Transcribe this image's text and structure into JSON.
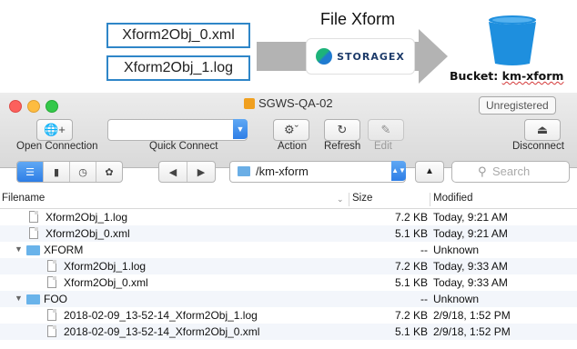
{
  "diagram": {
    "file1": "Xform2Obj_0.xml",
    "file2": "Xform2Obj_1.log",
    "xform_title": "File Xform",
    "storagex_label": "STORAGEX",
    "bucket_prefix": "Bucket: ",
    "bucket_name": "km-xform",
    "colors": {
      "box_border": "#2f86c8",
      "bucket": "#1e8fde",
      "arrow": "#b3b3b3"
    }
  },
  "window": {
    "title": "SGWS-QA-02",
    "unregistered": "Unregistered"
  },
  "toolbar": {
    "open_connection": "Open Connection",
    "quick_connect": "Quick Connect",
    "action": "Action",
    "refresh": "Refresh",
    "edit": "Edit",
    "disconnect": "Disconnect",
    "quick_connect_value": ""
  },
  "nav": {
    "path": "/km-xform",
    "search_placeholder": "Search"
  },
  "table": {
    "columns": {
      "filename": "Filename",
      "size": "Size",
      "modified": "Modified"
    },
    "rows": [
      {
        "name": "Xform2Obj_1.log",
        "size": "7.2 KB",
        "modified": "Today, 9:21 AM",
        "kind": "file",
        "depth": 0
      },
      {
        "name": "Xform2Obj_0.xml",
        "size": "5.1 KB",
        "modified": "Today, 9:21 AM",
        "kind": "file",
        "depth": 0
      },
      {
        "name": "XFORM",
        "size": "--",
        "modified": "Unknown",
        "kind": "folder",
        "depth": 0
      },
      {
        "name": "Xform2Obj_1.log",
        "size": "7.2 KB",
        "modified": "Today, 9:33 AM",
        "kind": "file",
        "depth": 1
      },
      {
        "name": "Xform2Obj_0.xml",
        "size": "5.1 KB",
        "modified": "Today, 9:33 AM",
        "kind": "file",
        "depth": 1
      },
      {
        "name": "FOO",
        "size": "--",
        "modified": "Unknown",
        "kind": "folder",
        "depth": 0
      },
      {
        "name": "2018-02-09_13-52-14_Xform2Obj_1.log",
        "size": "7.2 KB",
        "modified": "2/9/18, 1:52 PM",
        "kind": "file",
        "depth": 1
      },
      {
        "name": "2018-02-09_13-52-14_Xform2Obj_0.xml",
        "size": "5.1 KB",
        "modified": "2/9/18, 1:52 PM",
        "kind": "file",
        "depth": 1
      }
    ]
  }
}
